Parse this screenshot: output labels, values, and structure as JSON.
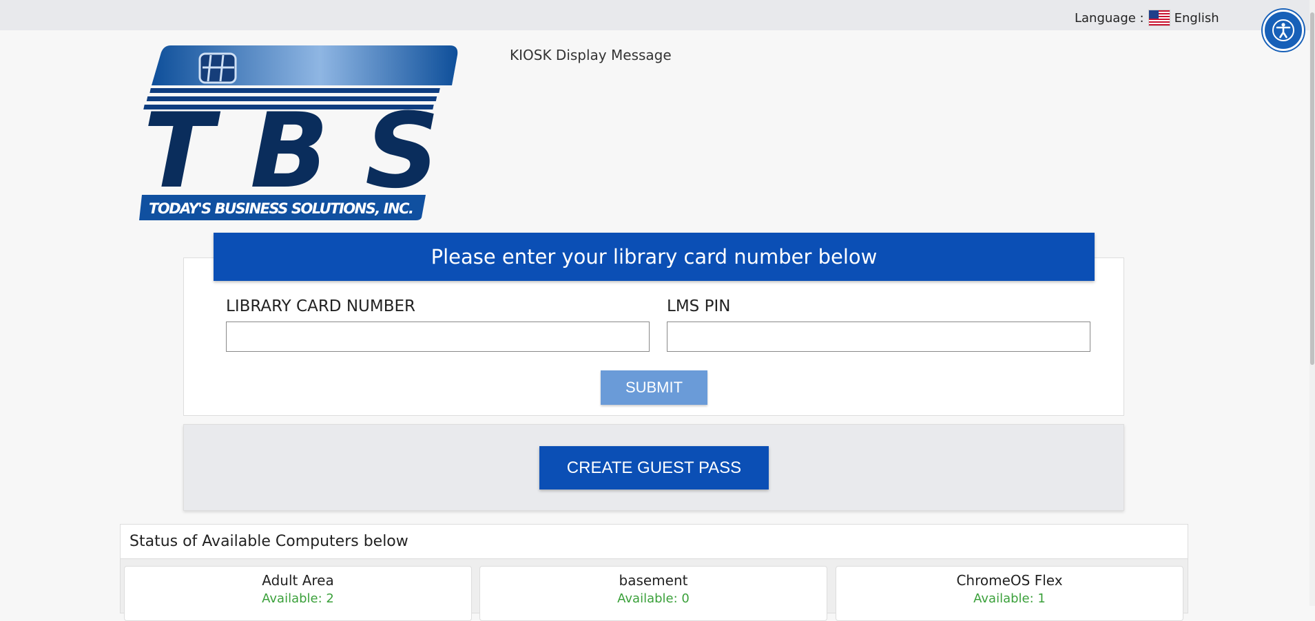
{
  "header": {
    "language_label": "Language :",
    "language_value": "English",
    "flag_icon": "us-flag-icon",
    "accessibility_icon": "accessibility-icon",
    "accent_color": "#1760b8"
  },
  "logo": {
    "brand": "TBS",
    "tagline": "TODAY'S BUSINESS SOLUTIONS, INC."
  },
  "kiosk_message": "KIOSK Display Message",
  "login": {
    "banner": "Please enter your library card number below",
    "card_label": "LIBRARY CARD NUMBER",
    "card_value": "",
    "pin_label": "LMS PIN",
    "pin_value": "",
    "submit_label": "SUBMIT",
    "banner_color": "#0b4fb5"
  },
  "guest": {
    "button_label": "CREATE GUEST PASS"
  },
  "status": {
    "title": "Status of Available Computers below",
    "computers": [
      {
        "name": "Adult Area",
        "available": "Available: 2"
      },
      {
        "name": "basement",
        "available": "Available: 0"
      },
      {
        "name": "ChromeOS Flex",
        "available": "Available: 1"
      }
    ],
    "available_color": "#3aa03a"
  }
}
